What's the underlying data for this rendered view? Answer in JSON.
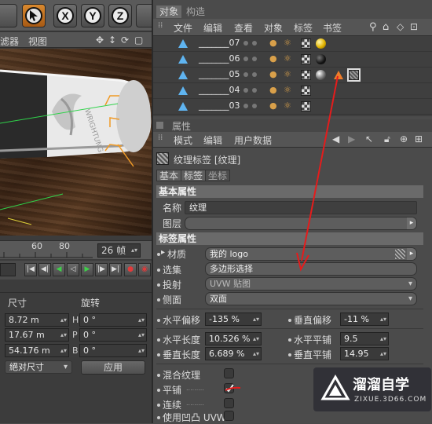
{
  "left_toolbar": {
    "axis_x": "X",
    "axis_y": "Y",
    "axis_z": "Z"
  },
  "left_menu": {
    "filter": "滤器",
    "view": "视图"
  },
  "timeline": {
    "tick_60": "60",
    "tick_80": "80",
    "frame_value": "26 帧"
  },
  "coords": {
    "size_label": "尺寸",
    "rotation_label": "旋转",
    "rows": [
      {
        "size": "8.72 m",
        "axis": "H",
        "rot": "0 °"
      },
      {
        "size": "17.67 m",
        "axis": "P",
        "rot": "0 °"
      },
      {
        "size": "54.176 m",
        "axis": "B",
        "rot": "0 °"
      }
    ],
    "mode": "絕对尺寸",
    "apply": "应用"
  },
  "object_manager": {
    "tab_objects": "对象",
    "tab_structure": "构造",
    "menu": [
      "文件",
      "编辑",
      "查看",
      "对象",
      "标签",
      "书签"
    ],
    "rows": [
      {
        "name": "_______07"
      },
      {
        "name": "_______06"
      },
      {
        "name": "_______05"
      },
      {
        "name": "_______04"
      },
      {
        "name": "_______03"
      }
    ]
  },
  "attributes": {
    "header": "属性",
    "menu": [
      "模式",
      "编辑",
      "用户数据"
    ],
    "title": "纹理标签 [纹理]",
    "tabs": [
      "基本",
      "标签",
      "坐标"
    ],
    "basic_section": "基本属性",
    "name_label": "名称",
    "name_value": "纹理",
    "layer_label": "图层",
    "tag_section": "标签属性",
    "material_label": "材质",
    "material_value": "我的 logo",
    "selection_label": "选集",
    "selection_value": "多边形选择",
    "projection_label": "投射",
    "projection_value": "UVW 贴图",
    "side_label": "侧面",
    "side_value": "双面",
    "offset_u_label": "水平偏移",
    "offset_u_value": "-135 %",
    "offset_v_label": "垂直偏移",
    "offset_v_value": "-11 %",
    "length_u_label": "水平长度",
    "length_u_value": "10.526 %",
    "tiles_u_label": "水平平铺",
    "tiles_u_value": "9.5",
    "length_v_label": "垂直长度",
    "length_v_value": "6.689 %",
    "tiles_v_label": "垂直平铺",
    "tiles_v_value": "14.95",
    "mix_label": "混合纹理",
    "tile_label": "平铺",
    "seamless_label": "连续",
    "bump_label": "使用凹凸 UVW"
  },
  "watermark": {
    "brand": "溜溜自学",
    "url": "ZIXUE.3D66.COM"
  },
  "colors": {
    "annotation_red": "#e41c1c",
    "object_icon": "#5fb4f0"
  }
}
